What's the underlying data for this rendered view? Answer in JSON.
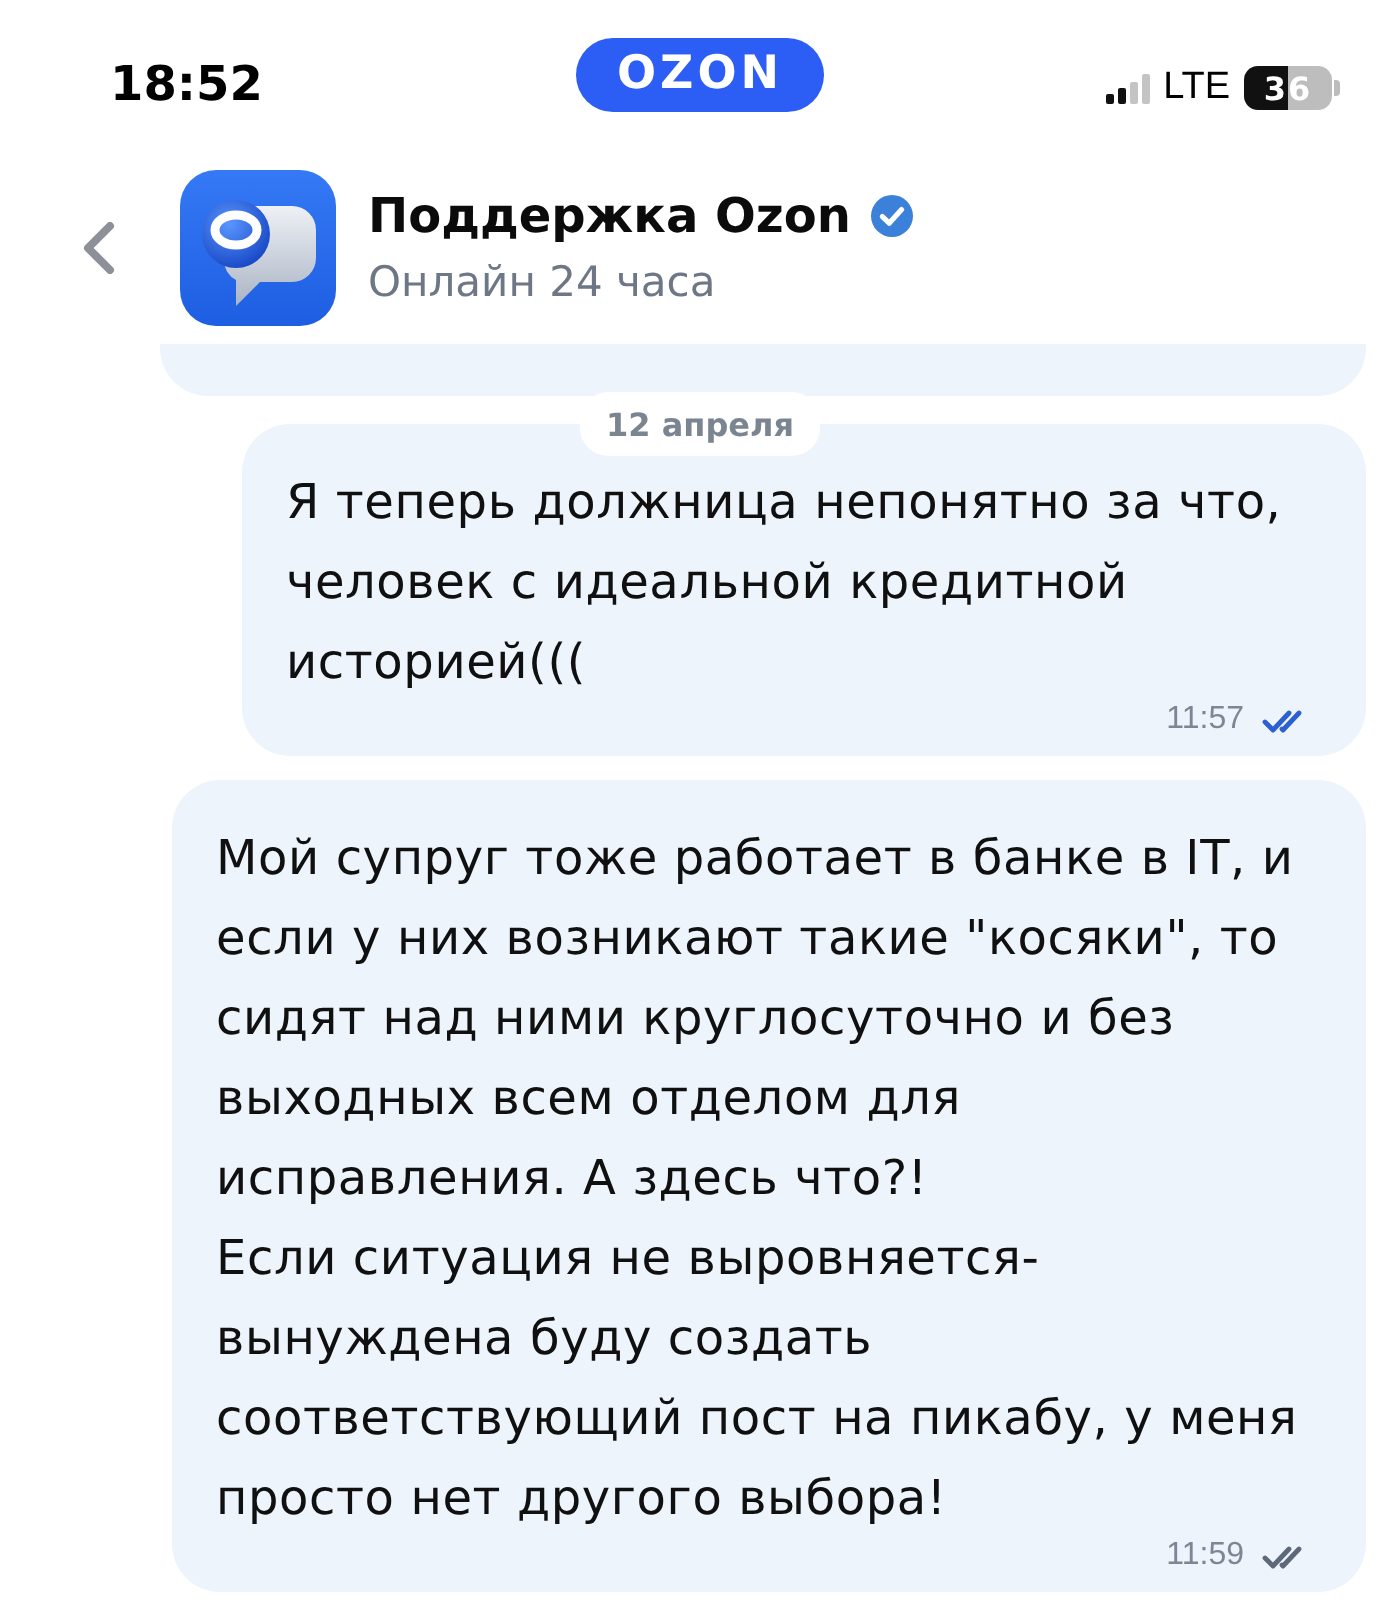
{
  "status_bar": {
    "time": "18:52",
    "logo": "OZON",
    "network": "LTE",
    "battery": "36"
  },
  "header": {
    "title": "Поддержка Ozon",
    "verified": true,
    "subtitle": "Онлайн 24 часа"
  },
  "date_label": "12 апреля",
  "messages": [
    {
      "text": "Я теперь должница непонятно за что, человек с идеальной кредитной историей(((",
      "time": "11:57",
      "read": true
    },
    {
      "text": "Мой супруг тоже работает в банке в IT, и если у них возникают такие \"косяки\", то сидят над ними круглосуточно и без выходных всем отделом для исправления. А здесь что?!\nЕсли ситуация не выровняется-вынуждена буду создать соответствующий пост на пикабу, у меня просто нет другого выбора!",
      "time": "11:59",
      "read": false
    }
  ]
}
